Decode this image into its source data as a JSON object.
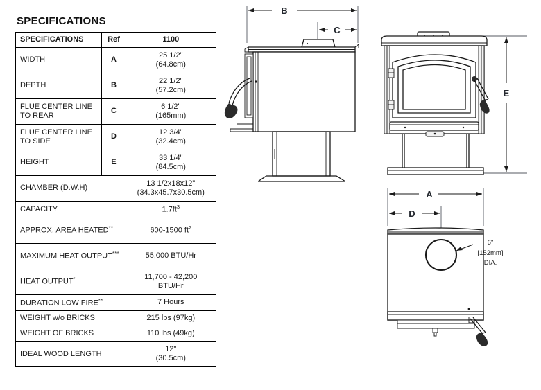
{
  "specifications": {
    "heading": "SPECIFICATIONS",
    "columns": [
      "SPECIFICATIONS",
      "Ref",
      "1100"
    ],
    "rows": [
      {
        "label": "WIDTH",
        "ref": "A",
        "value_primary": "25 1/2\"",
        "value_secondary": "(64.8cm)"
      },
      {
        "label": "DEPTH",
        "ref": "B",
        "value_primary": "22 1/2\"",
        "value_secondary": "(57.2cm)"
      },
      {
        "label": "FLUE CENTER LINE TO REAR",
        "ref": "C",
        "value_primary": "6 1/2\"",
        "value_secondary": "(165mm)"
      },
      {
        "label": "FLUE CENTER LINE TO SIDE",
        "ref": "D",
        "value_primary": "12 3/4\"",
        "value_secondary": "(32.4cm)"
      },
      {
        "label": "HEIGHT",
        "ref": "E",
        "value_primary": "33 1/4\"",
        "value_secondary": "(84.5cm)"
      }
    ],
    "merged_rows": [
      {
        "label": "CHAMBER (D.W.H)",
        "value_primary": "13 1/2x18x12\"",
        "value_secondary": "(34.3x45.7x30.5cm)"
      },
      {
        "label": "CAPACITY",
        "value_primary": "1.7ft",
        "value_superscript": "3",
        "value_secondary": ""
      },
      {
        "label": "APPROX. AREA HEATED",
        "label_superscript": "**",
        "value_primary": "600-1500 ft",
        "value_superscript": "2",
        "value_secondary": ""
      },
      {
        "label": "MAXIMUM HEAT OUTPUT",
        "label_superscript": "***",
        "value_primary": "55,000 BTU/Hr",
        "value_secondary": ""
      },
      {
        "label": "HEAT OUTPUT",
        "label_superscript": "*",
        "value_primary": "11,700 - 42,200",
        "value_secondary": "BTU/Hr"
      },
      {
        "label": "DURATION LOW FIRE",
        "label_superscript": "**",
        "value_primary": "7 Hours",
        "value_secondary": ""
      },
      {
        "label": "WEIGHT w/o BRICKS",
        "value_primary": "215 lbs (97kg)",
        "value_secondary": ""
      },
      {
        "label": "WEIGHT OF BRICKS",
        "value_primary": "110 lbs (49kg)",
        "value_secondary": ""
      },
      {
        "label": "IDEAL WOOD LENGTH",
        "value_primary": "12\"",
        "value_secondary": "(30.5cm)"
      }
    ]
  },
  "drawings": {
    "side_view": {
      "name": "side-view",
      "dimension_labels": [
        "B",
        "C"
      ]
    },
    "front_view": {
      "name": "front-view",
      "dimension_labels": [
        "E"
      ]
    },
    "top_view": {
      "name": "top-view",
      "dimension_labels": [
        "A",
        "D"
      ],
      "flue_note": {
        "line1": "6\"",
        "line2": "[152mm]",
        "line3": "DIA."
      }
    }
  },
  "colors": {
    "ink": "#1a1a1a",
    "dim_letter": "#23272e",
    "rule": "#000000",
    "page_background": "#ffffff"
  }
}
